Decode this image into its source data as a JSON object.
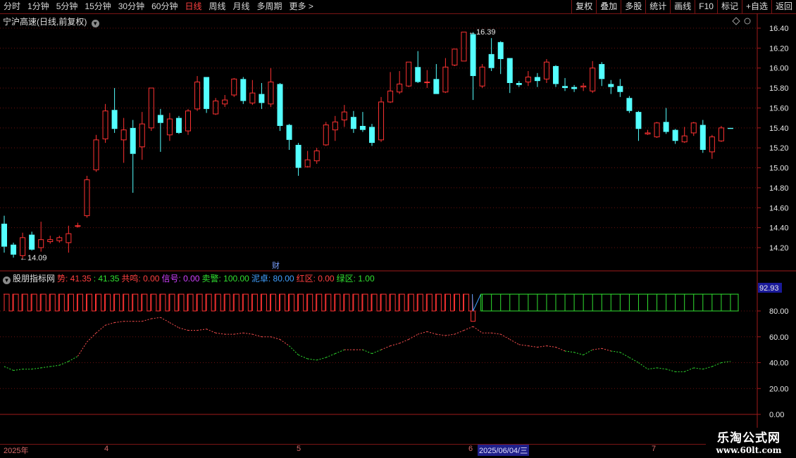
{
  "toolbar": {
    "periods": [
      "分时",
      "1分钟",
      "5分钟",
      "15分钟",
      "30分钟",
      "60分钟",
      "日线",
      "周线",
      "月线",
      "多周期",
      "更多 >"
    ],
    "active": "日线",
    "actions": [
      "复权",
      "叠加",
      "多股",
      "统计",
      "画线",
      "F10",
      "标记",
      "+自选",
      "返回"
    ]
  },
  "main_title": "宁沪高速(日线,前复权)",
  "price_axis": [
    "16.40",
    "16.20",
    "16.00",
    "15.80",
    "15.60",
    "15.40",
    "15.20",
    "15.00",
    "14.80",
    "14.60",
    "14.40",
    "14.20"
  ],
  "markers": {
    "high": "16.39",
    "low": "14.09",
    "event": "财"
  },
  "indicator": {
    "name": "股朋指标网",
    "fields": [
      {
        "label": "势:",
        "value": "41.35",
        "color": "#ff4040"
      },
      {
        "label": ":",
        "value": "41.35",
        "color": "#30e030"
      },
      {
        "label": "共鸣:",
        "value": "0.00",
        "color": "#ff4040"
      },
      {
        "label": "信号:",
        "value": "0.00",
        "color": "#d040ff"
      },
      {
        "label": "卖警:",
        "value": "100.00",
        "color": "#30e030"
      },
      {
        "label": "泥卓:",
        "value": "80.00",
        "color": "#40a0ff"
      },
      {
        "label": "红区:",
        "value": "0.00",
        "color": "#ff4040"
      },
      {
        "label": "绿区:",
        "value": "1.00",
        "color": "#30e030"
      }
    ],
    "axis": [
      "80.00",
      "60.00",
      "40.00",
      "20.00",
      "0.00"
    ],
    "current": "92.93"
  },
  "time_axis": {
    "year": "2025年",
    "months": [
      "4",
      "5",
      "6",
      "7"
    ],
    "selected": "2025/06/04/三"
  },
  "watermark": {
    "line1": "乐淘公式网",
    "line2": "www.60lt.com"
  },
  "colors": {
    "up": "#ff3232",
    "down": "#54ffff",
    "grid": "#7a1414"
  },
  "chart_data": {
    "type": "candlestick",
    "ylim": [
      14.05,
      16.5
    ],
    "candles": [
      [
        14.44,
        14.21,
        14.52,
        14.15
      ],
      [
        14.23,
        14.13,
        14.25,
        14.1
      ],
      [
        14.12,
        14.3,
        14.35,
        14.09
      ],
      [
        14.33,
        14.18,
        14.36,
        14.17
      ],
      [
        14.2,
        14.28,
        14.46,
        14.16
      ],
      [
        14.26,
        14.28,
        14.32,
        14.24
      ],
      [
        14.27,
        14.3,
        14.32,
        14.25
      ],
      [
        14.25,
        14.34,
        14.42,
        14.15
      ],
      [
        14.42,
        14.42,
        14.45,
        14.4
      ],
      [
        14.52,
        14.88,
        14.92,
        14.5
      ],
      [
        14.98,
        15.28,
        15.33,
        14.96
      ],
      [
        15.29,
        15.57,
        15.64,
        15.25
      ],
      [
        15.58,
        15.39,
        15.8,
        15.35
      ],
      [
        15.28,
        15.38,
        15.5,
        15.05
      ],
      [
        15.4,
        15.14,
        15.48,
        14.75
      ],
      [
        15.21,
        15.44,
        15.56,
        15.08
      ],
      [
        15.4,
        15.8,
        15.8,
        15.37
      ],
      [
        15.53,
        15.45,
        15.59,
        15.16
      ],
      [
        15.33,
        15.49,
        15.55,
        15.27
      ],
      [
        15.5,
        15.35,
        15.52,
        15.34
      ],
      [
        15.37,
        15.57,
        15.59,
        15.33
      ],
      [
        15.59,
        15.86,
        15.92,
        15.57
      ],
      [
        15.91,
        15.59,
        15.91,
        15.55
      ],
      [
        15.54,
        15.67,
        15.7,
        15.53
      ],
      [
        15.64,
        15.68,
        15.73,
        15.61
      ],
      [
        15.73,
        15.89,
        15.9,
        15.71
      ],
      [
        15.89,
        15.67,
        15.91,
        15.64
      ],
      [
        15.65,
        15.75,
        15.88,
        15.63
      ],
      [
        15.74,
        15.65,
        15.85,
        15.59
      ],
      [
        15.64,
        15.86,
        16.0,
        15.61
      ],
      [
        15.84,
        15.42,
        15.85,
        15.37
      ],
      [
        15.43,
        15.28,
        15.44,
        15.18
      ],
      [
        15.23,
        15.0,
        15.25,
        14.92
      ],
      [
        15.01,
        15.08,
        15.17,
        15.02
      ],
      [
        15.07,
        15.17,
        15.2,
        15.04
      ],
      [
        15.23,
        15.43,
        15.46,
        15.22
      ],
      [
        15.38,
        15.46,
        15.52,
        15.27
      ],
      [
        15.48,
        15.56,
        15.63,
        15.41
      ],
      [
        15.51,
        15.39,
        15.57,
        15.35
      ],
      [
        15.42,
        15.38,
        15.56,
        15.36
      ],
      [
        15.41,
        15.25,
        15.44,
        15.22
      ],
      [
        15.28,
        15.66,
        15.71,
        15.26
      ],
      [
        15.66,
        15.77,
        15.96,
        15.65
      ],
      [
        15.76,
        15.84,
        15.97,
        15.74
      ],
      [
        15.82,
        16.06,
        16.06,
        15.81
      ],
      [
        16.01,
        15.86,
        16.17,
        15.85
      ],
      [
        15.86,
        15.86,
        15.98,
        15.8
      ],
      [
        15.89,
        15.74,
        16.04,
        15.74
      ],
      [
        15.76,
        16.01,
        16.1,
        15.75
      ],
      [
        16.03,
        16.19,
        16.19,
        16.02
      ],
      [
        16.07,
        16.36,
        16.36,
        16.07
      ],
      [
        16.34,
        15.92,
        16.36,
        15.68
      ],
      [
        15.82,
        16.01,
        16.04,
        15.8
      ],
      [
        16.14,
        16.0,
        16.3,
        15.97
      ],
      [
        16.26,
        16.09,
        16.27,
        15.94
      ],
      [
        16.1,
        15.85,
        16.1,
        15.75
      ],
      [
        15.85,
        15.83,
        15.87,
        15.81
      ],
      [
        15.86,
        15.91,
        15.97,
        15.82
      ],
      [
        15.91,
        15.87,
        15.95,
        15.81
      ],
      [
        15.89,
        16.06,
        16.09,
        15.85
      ],
      [
        16.02,
        15.84,
        16.03,
        15.81
      ],
      [
        15.82,
        15.8,
        15.9,
        15.77
      ],
      [
        15.81,
        15.79,
        15.83,
        15.76
      ],
      [
        15.81,
        15.82,
        15.85,
        15.77
      ],
      [
        15.77,
        16.0,
        16.07,
        15.75
      ],
      [
        16.04,
        15.89,
        16.06,
        15.82
      ],
      [
        15.84,
        15.81,
        15.88,
        15.74
      ],
      [
        15.82,
        15.76,
        15.89,
        15.71
      ],
      [
        15.7,
        15.57,
        15.72,
        15.55
      ],
      [
        15.56,
        15.39,
        15.57,
        15.27
      ],
      [
        15.34,
        15.35,
        15.38,
        15.33
      ],
      [
        15.31,
        15.45,
        15.46,
        15.3
      ],
      [
        15.46,
        15.36,
        15.6,
        15.34
      ],
      [
        15.38,
        15.27,
        15.39,
        15.24
      ],
      [
        15.26,
        15.32,
        15.41,
        15.25
      ],
      [
        15.35,
        15.45,
        15.46,
        15.32
      ],
      [
        15.43,
        15.18,
        15.48,
        15.15
      ],
      [
        15.16,
        15.31,
        15.33,
        15.09
      ],
      [
        15.27,
        15.4,
        15.42,
        15.26
      ],
      [
        15.4,
        15.39,
        15.4,
        15.39
      ]
    ],
    "indicator_line": [
      37,
      34,
      35,
      35,
      36,
      37,
      38,
      41,
      45,
      56,
      63,
      69,
      71,
      72,
      72,
      72,
      74,
      75,
      71,
      67,
      65,
      65,
      66,
      63,
      62,
      62,
      63,
      62,
      60,
      60,
      58,
      53,
      46,
      43,
      42,
      44,
      47,
      50,
      50,
      50,
      47,
      50,
      53,
      55,
      58,
      62,
      64,
      62,
      61,
      62,
      65,
      68,
      63,
      63,
      62,
      58,
      54,
      53,
      52,
      53,
      52,
      49,
      48,
      46,
      50,
      51,
      49,
      48,
      44,
      40,
      35,
      36,
      35,
      33,
      33,
      36,
      35,
      37,
      40,
      41
    ],
    "band_top": [
      93,
      93,
      93,
      93,
      93,
      93,
      93,
      93,
      93,
      93,
      93,
      93,
      93,
      93,
      93,
      93,
      93,
      93,
      93,
      93,
      93,
      93,
      93,
      93,
      93,
      93,
      93,
      93,
      93,
      93,
      93,
      93,
      93,
      93,
      93,
      93,
      93,
      93,
      93,
      93,
      93,
      93,
      93,
      93,
      93,
      93,
      93,
      93,
      93,
      93,
      93,
      80,
      93,
      93,
      93,
      93,
      93,
      93,
      93,
      93,
      93,
      93,
      93,
      93,
      93,
      93,
      93,
      93,
      93,
      93,
      93,
      93,
      93,
      93,
      93,
      93,
      93,
      93,
      93,
      93
    ],
    "band_color": [
      "up",
      "up",
      "up",
      "up",
      "up",
      "up",
      "up",
      "up",
      "up",
      "up",
      "up",
      "up",
      "up",
      "up",
      "up",
      "up",
      "up",
      "up",
      "up",
      "up",
      "up",
      "up",
      "up",
      "up",
      "up",
      "up",
      "up",
      "up",
      "up",
      "up",
      "up",
      "up",
      "up",
      "up",
      "up",
      "up",
      "up",
      "up",
      "up",
      "up",
      "up",
      "up",
      "up",
      "up",
      "up",
      "up",
      "up",
      "up",
      "up",
      "up",
      "up",
      "up",
      "down",
      "down",
      "down",
      "down",
      "down",
      "down",
      "down",
      "down",
      "down",
      "down",
      "down",
      "down",
      "down",
      "down",
      "down",
      "down",
      "down",
      "down",
      "down",
      "down",
      "down",
      "down",
      "down",
      "down",
      "down",
      "down",
      "down",
      "down"
    ]
  }
}
